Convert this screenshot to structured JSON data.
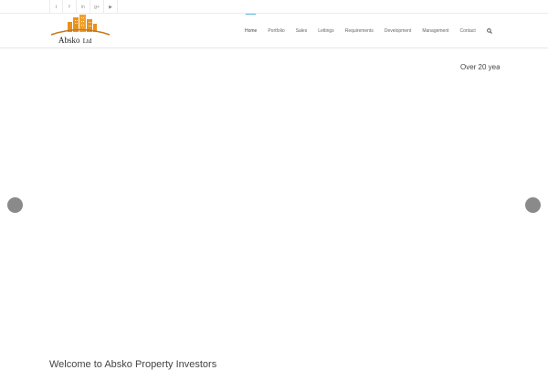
{
  "social": [
    {
      "icon": "twitter-icon",
      "glyph": "t"
    },
    {
      "icon": "facebook-icon",
      "glyph": "f"
    },
    {
      "icon": "linkedin-icon",
      "glyph": "in"
    },
    {
      "icon": "google-plus-icon",
      "glyph": "g+"
    },
    {
      "icon": "youtube-icon",
      "glyph": "▶"
    }
  ],
  "logo": {
    "name": "Absko",
    "suffix": "Ltd"
  },
  "nav": {
    "items": [
      {
        "label": "Home",
        "active": true
      },
      {
        "label": "Portfolio",
        "active": false
      },
      {
        "label": "Sales",
        "active": false
      },
      {
        "label": "Lettings",
        "active": false
      },
      {
        "label": "Requirements",
        "active": false
      },
      {
        "label": "Development",
        "active": false
      },
      {
        "label": "Management",
        "active": false
      },
      {
        "label": "Contact",
        "active": false
      }
    ]
  },
  "slider": {
    "caption": "Over 20 yea"
  },
  "welcome": {
    "heading": "Welcome to Absko Property Investors"
  },
  "colors": {
    "accent": "#5fb9d3",
    "logo_orange": "#e8921e",
    "arrow": "#8a8a8a"
  }
}
